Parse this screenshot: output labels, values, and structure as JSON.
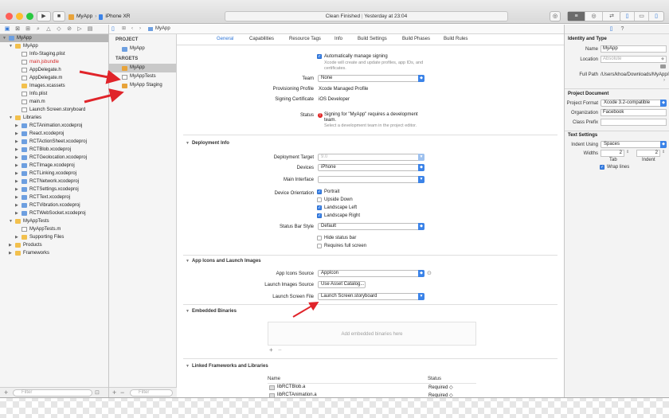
{
  "toolbar": {
    "scheme": "MyApp",
    "device": "iPhone XR",
    "status": "Clean Finished",
    "status_time": "Yesterday at 23:04"
  },
  "navigator": {
    "rows": [
      {
        "label": "MyApp",
        "level": 0,
        "disc": "▼",
        "icon": "proj",
        "selected": true,
        "red": false
      },
      {
        "label": "MyApp",
        "level": 1,
        "disc": "▼",
        "icon": "folder",
        "selected": false,
        "red": false
      },
      {
        "label": "Info-Staging.plist",
        "level": 2,
        "disc": "",
        "icon": "file",
        "selected": false,
        "red": false
      },
      {
        "label": "main.jsbundle",
        "level": 2,
        "disc": "",
        "icon": "file",
        "selected": false,
        "red": true
      },
      {
        "label": "AppDelegate.h",
        "level": 2,
        "disc": "",
        "icon": "file",
        "selected": false,
        "red": false
      },
      {
        "label": "AppDelegate.m",
        "level": 2,
        "disc": "",
        "icon": "file",
        "selected": false,
        "red": false
      },
      {
        "label": "Images.xcassets",
        "level": 2,
        "disc": "",
        "icon": "folder",
        "selected": false,
        "red": false
      },
      {
        "label": "Info.plist",
        "level": 2,
        "disc": "",
        "icon": "file",
        "selected": false,
        "red": false
      },
      {
        "label": "main.m",
        "level": 2,
        "disc": "",
        "icon": "file",
        "selected": false,
        "red": false
      },
      {
        "label": "Launch Screen.storyboard",
        "level": 2,
        "disc": "",
        "icon": "file",
        "selected": false,
        "red": false
      },
      {
        "label": "Libraries",
        "level": 1,
        "disc": "▼",
        "icon": "folder",
        "selected": false,
        "red": false
      },
      {
        "label": "RCTAnimation.xcodeproj",
        "level": 2,
        "disc": "▶",
        "icon": "proj",
        "selected": false,
        "red": false
      },
      {
        "label": "React.xcodeproj",
        "level": 2,
        "disc": "▶",
        "icon": "proj",
        "selected": false,
        "red": false
      },
      {
        "label": "RCTActionSheet.xcodeproj",
        "level": 2,
        "disc": "▶",
        "icon": "proj",
        "selected": false,
        "red": false
      },
      {
        "label": "RCTBlob.xcodeproj",
        "level": 2,
        "disc": "▶",
        "icon": "proj",
        "selected": false,
        "red": false
      },
      {
        "label": "RCTGeolocation.xcodeproj",
        "level": 2,
        "disc": "▶",
        "icon": "proj",
        "selected": false,
        "red": false
      },
      {
        "label": "RCTImage.xcodeproj",
        "level": 2,
        "disc": "▶",
        "icon": "proj",
        "selected": false,
        "red": false
      },
      {
        "label": "RCTLinking.xcodeproj",
        "level": 2,
        "disc": "▶",
        "icon": "proj",
        "selected": false,
        "red": false
      },
      {
        "label": "RCTNetwork.xcodeproj",
        "level": 2,
        "disc": "▶",
        "icon": "proj",
        "selected": false,
        "red": false
      },
      {
        "label": "RCTSettings.xcodeproj",
        "level": 2,
        "disc": "▶",
        "icon": "proj",
        "selected": false,
        "red": false
      },
      {
        "label": "RCTText.xcodeproj",
        "level": 2,
        "disc": "▶",
        "icon": "proj",
        "selected": false,
        "red": false
      },
      {
        "label": "RCTVibration.xcodeproj",
        "level": 2,
        "disc": "▶",
        "icon": "proj",
        "selected": false,
        "red": false
      },
      {
        "label": "RCTWebSocket.xcodeproj",
        "level": 2,
        "disc": "▶",
        "icon": "proj",
        "selected": false,
        "red": false
      },
      {
        "label": "MyAppTests",
        "level": 1,
        "disc": "▼",
        "icon": "folder",
        "selected": false,
        "red": false
      },
      {
        "label": "MyAppTests.m",
        "level": 2,
        "disc": "",
        "icon": "file",
        "selected": false,
        "red": false
      },
      {
        "label": "Supporting Files",
        "level": 2,
        "disc": "▶",
        "icon": "folder",
        "selected": false,
        "red": false
      },
      {
        "label": "Products",
        "level": 1,
        "disc": "▶",
        "icon": "folder",
        "selected": false,
        "red": false
      },
      {
        "label": "Frameworks",
        "level": 1,
        "disc": "▶",
        "icon": "folder",
        "selected": false,
        "red": false
      }
    ],
    "filter_placeholder": "Filter"
  },
  "jumpbar": {
    "item": "MyApp"
  },
  "targets": {
    "project_header": "PROJECT",
    "project_item": "MyApp",
    "targets_header": "TARGETS",
    "items": [
      "MyApp",
      "MyAppTests",
      "MyApp Staging"
    ],
    "filter_placeholder": "Filter"
  },
  "tabs": [
    "General",
    "Capabilities",
    "Resource Tags",
    "Info",
    "Build Settings",
    "Build Phases",
    "Build Rules"
  ],
  "signing": {
    "auto_label": "Automatically manage signing",
    "auto_note": "Xcode will create and update profiles, app IDs, and certificates.",
    "team_label": "Team",
    "team_value": "None",
    "profile_label": "Provisioning Profile",
    "profile_value": "Xcode Managed Profile",
    "cert_label": "Signing Certificate",
    "cert_value": "iOS Developer",
    "status_label": "Status",
    "status_value": "Signing for \"MyApp\" requires a development team.",
    "status_note": "Select a development team in the project editor."
  },
  "deployment": {
    "title": "Deployment Info",
    "target_label": "Deployment Target",
    "target_value": "9.0",
    "devices_label": "Devices",
    "devices_value": "iPhone",
    "interface_label": "Main Interface",
    "interface_value": "",
    "orientation_label": "Device Orientation",
    "orientations": [
      {
        "label": "Portrait",
        "checked": true
      },
      {
        "label": "Upside Down",
        "checked": false
      },
      {
        "label": "Landscape Left",
        "checked": true
      },
      {
        "label": "Landscape Right",
        "checked": true
      }
    ],
    "statusbar_label": "Status Bar Style",
    "statusbar_value": "Default",
    "hide_status": "Hide status bar",
    "full_screen": "Requires full screen"
  },
  "icons": {
    "title": "App Icons and Launch Images",
    "app_icons_label": "App Icons Source",
    "app_icons_value": "AppIcon",
    "launch_images_label": "Launch Images Source",
    "launch_images_value": "Use Asset Catalog...",
    "launch_file_label": "Launch Screen File",
    "launch_file_value": "Launch Screen.storyboard"
  },
  "embedded": {
    "title": "Embedded Binaries",
    "placeholder": "Add embedded binaries here"
  },
  "linked": {
    "title": "Linked Frameworks and Libraries",
    "col_name": "Name",
    "col_status": "Status",
    "rows": [
      {
        "name": "libRCTBlob.a",
        "status": "Required ◇"
      },
      {
        "name": "libRCTAnimation.a",
        "status": "Required ◇"
      }
    ]
  },
  "inspector": {
    "identity_title": "Identity and Type",
    "name_label": "Name",
    "name_value": "MyApp",
    "location_label": "Location",
    "location_value": "Absolute",
    "fullpath_label": "Full Path",
    "fullpath_value": "/Users/khoa/Downloads/MyApp/ios/MyApp.xcodeproj",
    "projdoc_title": "Project Document",
    "format_label": "Project Format",
    "format_value": "Xcode 3.2-compatible",
    "org_label": "Organization",
    "org_value": "Facebook",
    "prefix_label": "Class Prefix",
    "prefix_value": "",
    "text_title": "Text Settings",
    "indent_label": "Indent Using",
    "indent_value": "Spaces",
    "widths_label": "Widths",
    "tab_value": "2",
    "indent_value_num": "2",
    "tab_caption": "Tab",
    "indent_caption": "Indent",
    "wrap_label": "Wrap lines"
  },
  "colors": {
    "accent": "#2b73d6",
    "annotation_arrow": "#e0242a",
    "traffic_red": "#ff5f57",
    "traffic_yellow": "#febc2e",
    "traffic_green": "#28c840"
  }
}
